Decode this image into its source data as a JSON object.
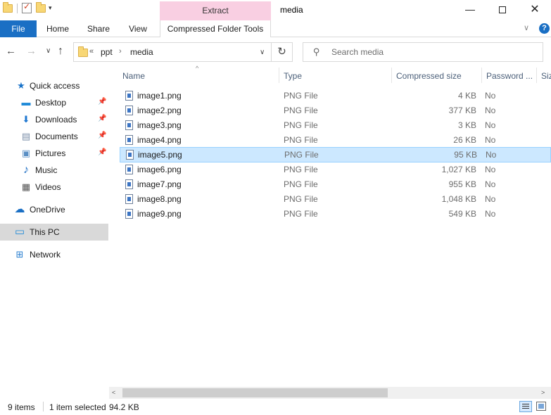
{
  "window": {
    "title": "media",
    "context_tab_group": "Extract",
    "minimize_glyph": "—",
    "close_glyph": "✕"
  },
  "ribbon": {
    "tabs": [
      "File",
      "Home",
      "Share",
      "View",
      "Compressed Folder Tools"
    ],
    "collapse_glyph": "∨",
    "help_glyph": "?"
  },
  "navigation": {
    "back_glyph": "←",
    "forward_glyph": "→",
    "recent_glyph": "∨",
    "up_glyph": "↑",
    "breadcrumb_more": "«",
    "breadcrumb": [
      "ppt",
      "media"
    ],
    "breadcrumb_sep": "›",
    "address_dropdown": "∨",
    "refresh_glyph": "↻",
    "search_placeholder": "Search media",
    "search_glyph": "⚲"
  },
  "sidebar": {
    "items": [
      {
        "label": "Quick access",
        "icon": "star-icon",
        "glyph": "★",
        "color": "#1a73c9",
        "pinned": false
      },
      {
        "label": "Desktop",
        "icon": "desktop-icon",
        "glyph": "▬",
        "color": "#1f8ad8",
        "pinned": true
      },
      {
        "label": "Downloads",
        "icon": "downloads-icon",
        "glyph": "⬇",
        "color": "#1f78d1",
        "pinned": true
      },
      {
        "label": "Documents",
        "icon": "documents-icon",
        "glyph": "▤",
        "color": "#7a8ea8",
        "pinned": true
      },
      {
        "label": "Pictures",
        "icon": "pictures-icon",
        "glyph": "▣",
        "color": "#5a8fc4",
        "pinned": true
      },
      {
        "label": "Music",
        "icon": "music-icon",
        "glyph": "♪",
        "color": "#1f6fc4",
        "pinned": false
      },
      {
        "label": "Videos",
        "icon": "videos-icon",
        "glyph": "▦",
        "color": "#555555",
        "pinned": false
      },
      {
        "label": "OneDrive",
        "icon": "cloud-icon",
        "glyph": "☁",
        "color": "#1a6fc4",
        "pinned": false
      },
      {
        "label": "This PC",
        "icon": "computer-icon",
        "glyph": "▭",
        "color": "#1f8ad8",
        "pinned": false
      },
      {
        "label": "Network",
        "icon": "network-icon",
        "glyph": "⊞",
        "color": "#2a7fd0",
        "pinned": false
      }
    ],
    "pin_glyph": "📌"
  },
  "columns": {
    "name": "Name",
    "type": "Type",
    "compressed_size": "Compressed size",
    "password": "Password ...",
    "size": "Siz",
    "sort_glyph": "^"
  },
  "files": [
    {
      "name": "image1.png",
      "type": "PNG File",
      "size": "4 KB",
      "password": "No"
    },
    {
      "name": "image2.png",
      "type": "PNG File",
      "size": "377 KB",
      "password": "No"
    },
    {
      "name": "image3.png",
      "type": "PNG File",
      "size": "3 KB",
      "password": "No"
    },
    {
      "name": "image4.png",
      "type": "PNG File",
      "size": "26 KB",
      "password": "No"
    },
    {
      "name": "image5.png",
      "type": "PNG File",
      "size": "95 KB",
      "password": "No"
    },
    {
      "name": "image6.png",
      "type": "PNG File",
      "size": "1,027 KB",
      "password": "No"
    },
    {
      "name": "image7.png",
      "type": "PNG File",
      "size": "955 KB",
      "password": "No"
    },
    {
      "name": "image8.png",
      "type": "PNG File",
      "size": "1,048 KB",
      "password": "No"
    },
    {
      "name": "image9.png",
      "type": "PNG File",
      "size": "549 KB",
      "password": "No"
    }
  ],
  "scrollbar": {
    "left_glyph": "<",
    "right_glyph": ">"
  },
  "status": {
    "item_count": "9 items",
    "selection": "1 item selected",
    "selection_size": "94.2 KB"
  }
}
